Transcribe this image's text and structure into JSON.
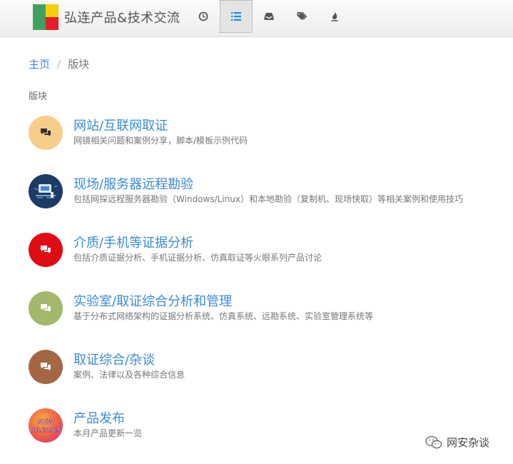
{
  "header": {
    "site_title": "弘连产品&技术交流",
    "nav_icons": [
      "clock-icon",
      "list-icon",
      "inbox-icon",
      "tags-icon",
      "fire-icon"
    ],
    "active_nav": "list-icon"
  },
  "breadcrumb": {
    "home": "主页",
    "separator": "/",
    "current": "版块"
  },
  "section_label": "版块",
  "categories": [
    {
      "title": "网站/互联网取证",
      "description": "网镜相关问题和案例分享，脚本/模板示例代码",
      "icon_color": "#f7cd8a",
      "icon": "comments-icon"
    },
    {
      "title": "现场/服务器远程勘验",
      "description": "包括网探远程服务器勘验（Windows/Linux）和本地勘验（复制机、现场快取）等相关案例和使用技巧",
      "icon_color": "#1d3b66",
      "icon": "server-image-icon"
    },
    {
      "title": "介质/手机等证据分析",
      "description": "包括介质证据分析、手机证据分析、仿真取证等火眼系列产品讨论",
      "icon_color": "#e00c13",
      "icon": "comments-icon"
    },
    {
      "title": "实验室/取证综合分析和管理",
      "description": "基于分布式网络架构的证据分析系统、仿真系统、远勘系统、实验室管理系统等",
      "icon_color": "#a4b86c",
      "icon": "comments-icon"
    },
    {
      "title": "取证综合/杂谈",
      "description": "案例、法律以及各种综合信息",
      "icon_color": "#a56743",
      "icon": "comments-icon"
    },
    {
      "title": "产品发布",
      "description": "本月产品更新一览",
      "icon_color": "#e24a8a",
      "icon": "new-releases-badge-icon",
      "badge_line1": "NEW",
      "badge_line2": "RELEASES"
    }
  ],
  "watermark": "网安杂谈"
}
